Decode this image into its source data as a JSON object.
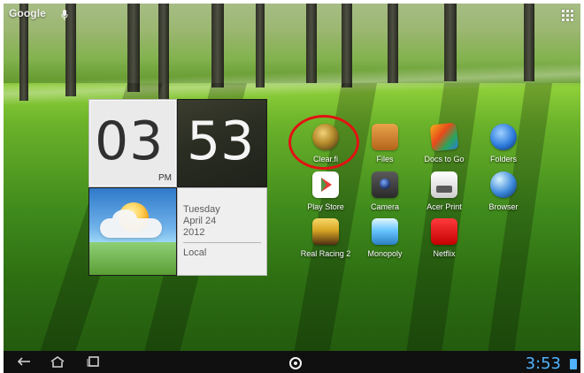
{
  "top_bar": {
    "search_label": "Google",
    "icons": [
      "mic-icon",
      "apps-grid-icon"
    ]
  },
  "clock_widget": {
    "hours": "03",
    "minutes": "53",
    "ampm": "PM"
  },
  "weather_widget": {
    "icon": "sun-cloud-icon"
  },
  "date_widget": {
    "weekday": "Tuesday",
    "month_day": "April 24",
    "year": "2012",
    "location": "Local"
  },
  "apps": [
    {
      "label": "Clear.fi",
      "icon": "clearfi-icon",
      "color": "#b58b2b",
      "highlighted": true
    },
    {
      "label": "Files",
      "icon": "files-icon",
      "color": "#c97a26"
    },
    {
      "label": "Docs to Go",
      "icon": "docs-icon",
      "color": "#f2b01e"
    },
    {
      "label": "Folders",
      "icon": "folders-icon",
      "color": "#2d7bdc"
    },
    {
      "label": "Play Store",
      "icon": "play-store-icon",
      "color": "#ffffff"
    },
    {
      "label": "Camera",
      "icon": "camera-icon",
      "color": "#444444"
    },
    {
      "label": "Acer Print",
      "icon": "print-icon",
      "color": "#e9e9e9"
    },
    {
      "label": "Browser",
      "icon": "browser-icon",
      "color": "#3a87d9"
    },
    {
      "label": "Real Racing 2",
      "icon": "racing-icon",
      "color": "#d8a623"
    },
    {
      "label": "Monopoly",
      "icon": "monopoly-icon",
      "color": "#6ac6ff"
    },
    {
      "label": "Netflix",
      "icon": "netflix-icon",
      "color": "#c40000"
    }
  ],
  "system_bar": {
    "time": "3:53",
    "icons": [
      "back-icon",
      "home-icon",
      "recents-icon",
      "center-indicator-icon",
      "battery-icon"
    ]
  },
  "colors": {
    "highlight": "#e21212",
    "system_time": "#4fb3ff"
  }
}
